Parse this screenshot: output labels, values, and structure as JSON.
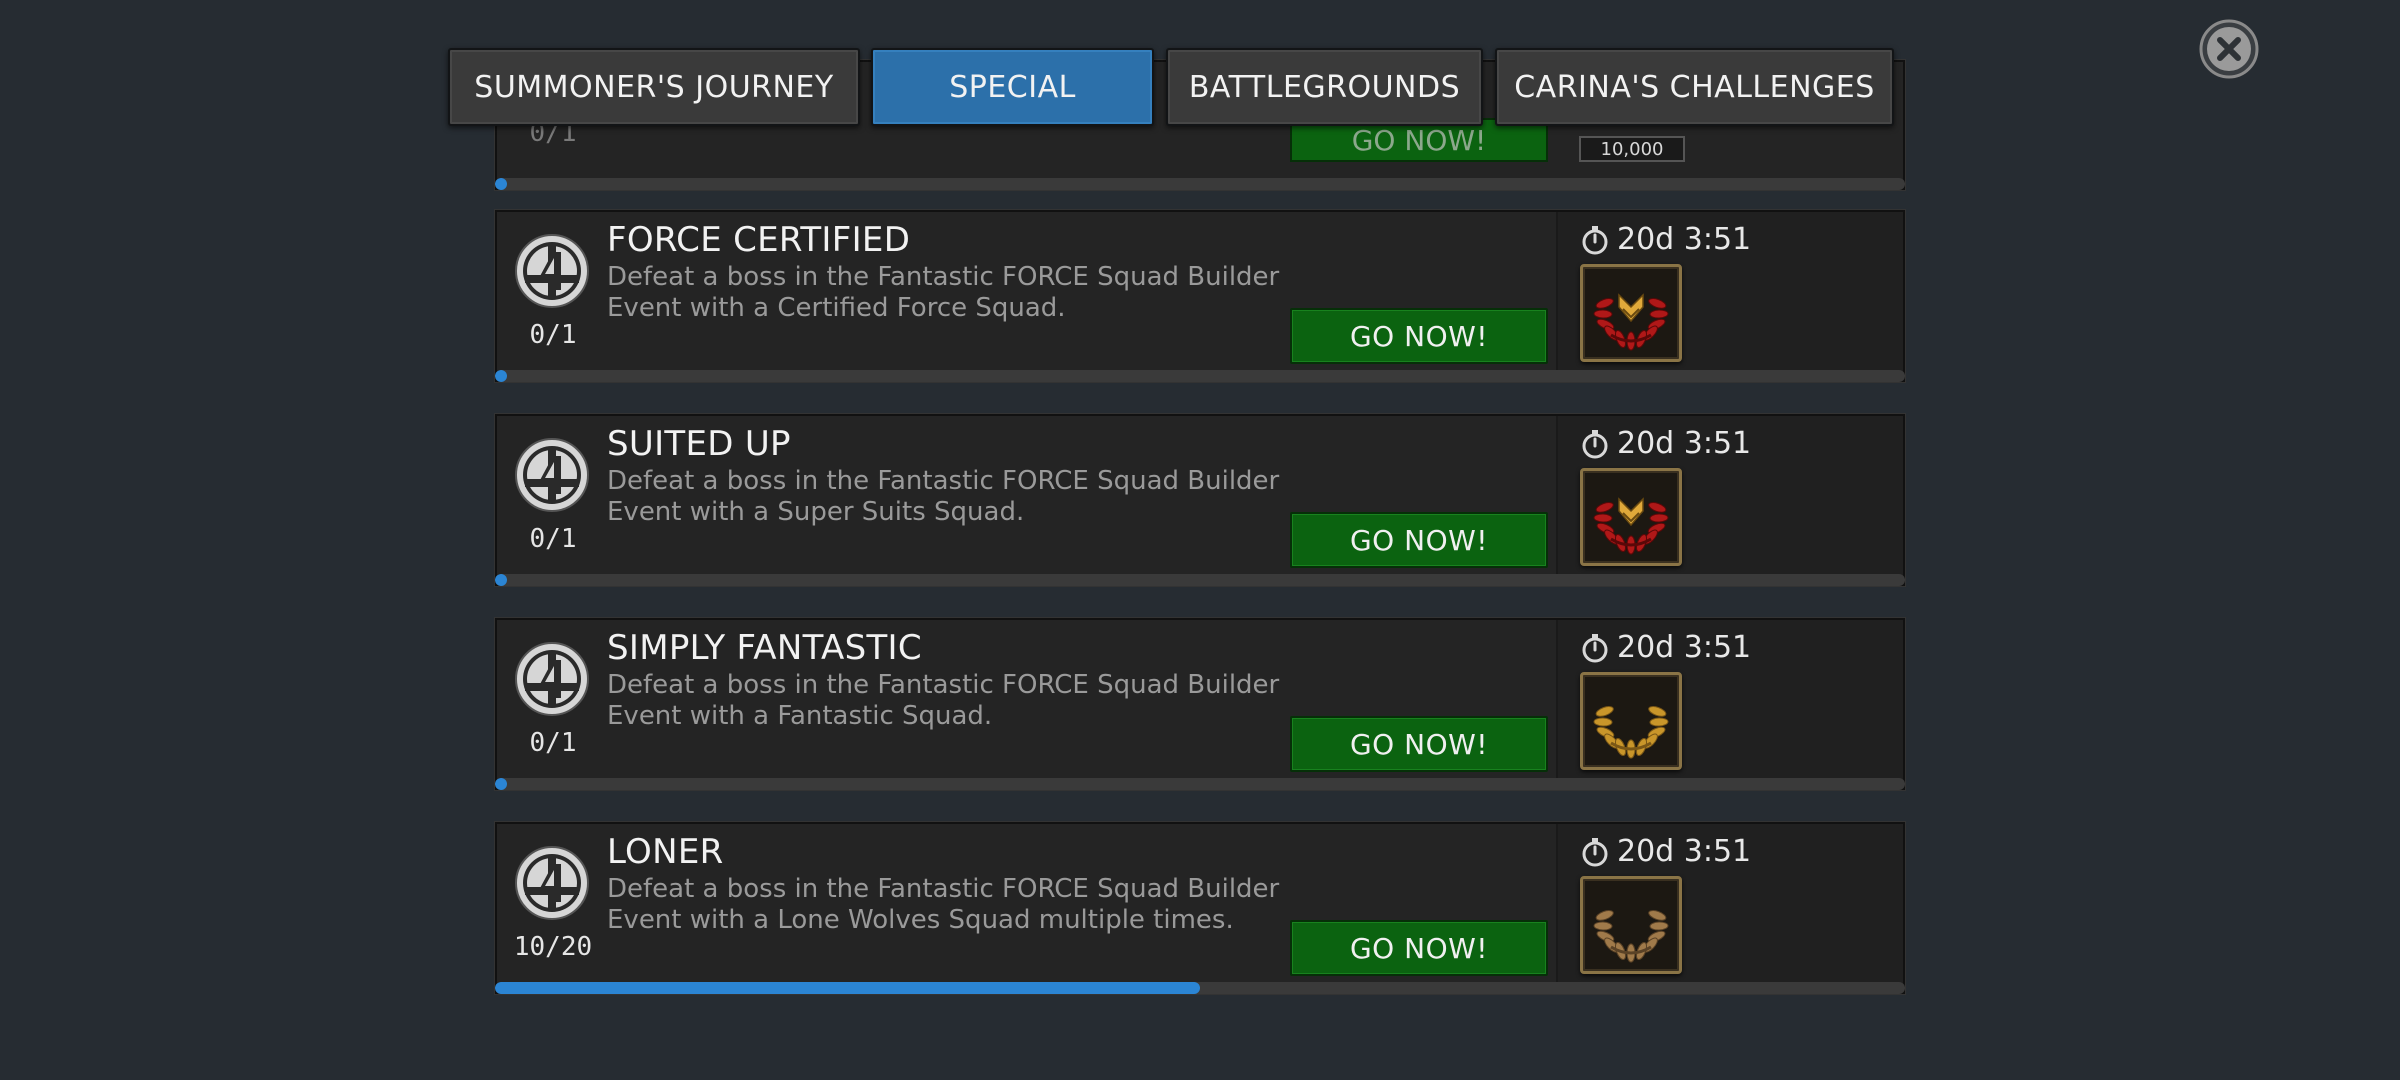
{
  "tabs": [
    {
      "label": "SUMMONER'S JOURNEY",
      "active": false
    },
    {
      "label": "SPECIAL",
      "active": true
    },
    {
      "label": "BATTLEGROUNDS",
      "active": false
    },
    {
      "label": "CARINA'S CHALLENGES",
      "active": false
    }
  ],
  "close_icon": "close-x-icon",
  "partial_card": {
    "count": "0/1",
    "button_label": "GO NOW!",
    "reward_label": "10,000",
    "progress": 0
  },
  "quests": [
    {
      "title": "FORCE CERTIFIED",
      "description": "Defeat a boss in the Fantastic FORCE Squad Builder Event with a Certified Force Squad.",
      "count": "0/1",
      "button_label": "GO NOW!",
      "timer": "20d 3:51",
      "reward_icon": "red-laurel-crest-icon",
      "progress": 0
    },
    {
      "title": "SUITED UP",
      "description": "Defeat a boss in the Fantastic FORCE Squad Builder Event with a Super Suits Squad.",
      "count": "0/1",
      "button_label": "GO NOW!",
      "timer": "20d 3:51",
      "reward_icon": "red-laurel-crest-icon",
      "progress": 0
    },
    {
      "title": "SIMPLY FANTASTIC",
      "description": "Defeat a boss in the Fantastic FORCE Squad Builder Event with a Fantastic Squad.",
      "count": "0/1",
      "button_label": "GO NOW!",
      "timer": "20d 3:51",
      "reward_icon": "gold-laurel-icon",
      "progress": 0
    },
    {
      "title": "LONER",
      "description": "Defeat a boss in the Fantastic FORCE Squad Builder Event with a Lone Wolves Squad multiple times.",
      "count": "10/20",
      "button_label": "GO NOW!",
      "timer": "20d 3:51",
      "reward_icon": "bronze-laurel-icon",
      "progress": 0.5
    }
  ],
  "colors": {
    "background": "#262c32",
    "tab_active": "#2c70aa",
    "button_green": "#0b6310",
    "progress_blue": "#2b85d4"
  }
}
